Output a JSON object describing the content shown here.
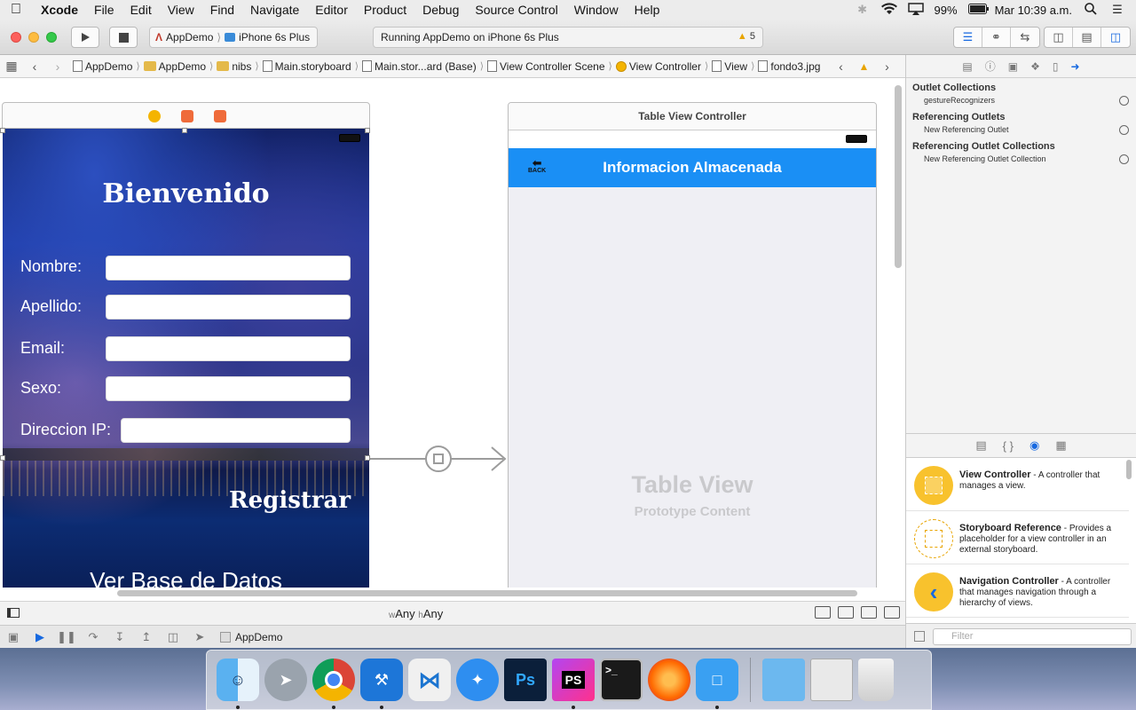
{
  "menubar": {
    "app_name": "Xcode",
    "items": [
      "File",
      "Edit",
      "View",
      "Find",
      "Navigate",
      "Editor",
      "Product",
      "Debug",
      "Source Control",
      "Window",
      "Help"
    ],
    "battery": "99%",
    "clock": "Mar 10:39 a.m."
  },
  "toolbar": {
    "scheme": "AppDemo",
    "device": "iPhone 6s Plus",
    "activity": "Running AppDemo on iPhone 6s Plus",
    "warning_count": "5"
  },
  "jumpbar": {
    "crumbs": [
      "AppDemo",
      "AppDemo",
      "nibs",
      "Main.storyboard",
      "Main.stor...ard (Base)",
      "View Controller Scene",
      "View Controller",
      "View",
      "fondo3.jpg"
    ]
  },
  "view_controller": {
    "title": "Bienvenido",
    "fields": [
      {
        "label": "Nombre:"
      },
      {
        "label": "Apellido:"
      },
      {
        "label": "Email:"
      },
      {
        "label": "Sexo:"
      },
      {
        "label": "Direccion IP:"
      }
    ],
    "register_button": "Registrar",
    "database_button": "Ver Base de Datos"
  },
  "table_view_controller": {
    "scene_title": "Table View Controller",
    "nav_title": "Informacion Almacenada",
    "back_label": "BACK",
    "placeholder_title": "Table View",
    "placeholder_subtitle": "Prototype Content"
  },
  "canvas_bar": {
    "width_prefix": "w",
    "width_value": "Any",
    "height_prefix": "h",
    "height_value": "Any"
  },
  "debug_bar": {
    "app_label": "AppDemo"
  },
  "inspector": {
    "sections": [
      {
        "heading": "Outlet Collections",
        "rows": [
          "gestureRecognizers"
        ]
      },
      {
        "heading": "Referencing Outlets",
        "rows": [
          "New Referencing Outlet"
        ]
      },
      {
        "heading": "Referencing Outlet Collections",
        "rows": [
          "New Referencing Outlet Collection"
        ]
      }
    ]
  },
  "library": {
    "items": [
      {
        "name": "View Controller",
        "desc": " - A controller that manages a view."
      },
      {
        "name": "Storyboard Reference",
        "desc": " - Provides a placeholder for a view controller in an external storyboard."
      },
      {
        "name": "Navigation Controller",
        "desc": " - A controller that manages navigation through a hierarchy of views."
      }
    ],
    "filter_placeholder": "Filter"
  },
  "dock": {
    "apps": [
      "finder-icon",
      "launchpad-icon",
      "chrome-icon",
      "xcode-icon",
      "vscode-icon",
      "safari-icon",
      "photoshop-icon",
      "phpstorm-icon",
      "terminal-icon",
      "firefox-icon",
      "simulator-icon",
      "folder-icon",
      "preview-icon",
      "trash-icon"
    ]
  },
  "colors": {
    "accent": "#1769e0",
    "nav_bar": "#1a8ff5",
    "traffic_red": "#fc605c",
    "traffic_yellow": "#fdbc40",
    "traffic_green": "#34c84a"
  }
}
